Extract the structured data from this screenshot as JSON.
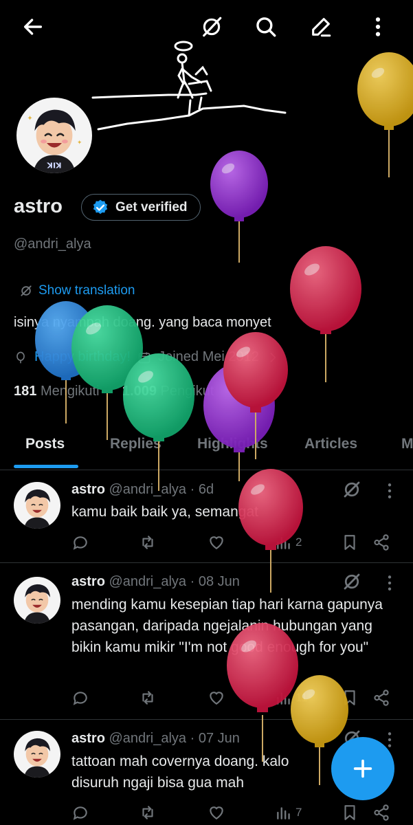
{
  "profile": {
    "name": "astro",
    "verify_label": "Get verified",
    "handle": "@andri_alya",
    "translate_label": "Show translation",
    "bio": "isinya nyampah doang.  yang baca monyet",
    "birthday": "Happy birthday!",
    "joined": "Joined Mei 2012",
    "following_count": "181",
    "following_label": "Mengikuti",
    "followers_count": "1.009",
    "followers_label": "Pengikut"
  },
  "tabs": [
    "Posts",
    "Replies",
    "Highlights",
    "Articles",
    "M"
  ],
  "posts": [
    {
      "name": "astro",
      "handle": "@andri_alya · 6d",
      "text": "kamu baik baik ya, semangat",
      "views": "2"
    },
    {
      "name": "astro",
      "handle": "@andri_alya · 08 Jun",
      "text": "mending kamu kesepian tiap hari karna gapunya pasangan, daripada ngejalanin hubungan yang bikin kamu mikir \"I'm not good enough for you\"",
      "views": "11"
    },
    {
      "name": "astro",
      "handle": "@andri_alya · 07 Jun",
      "text": "tattoan mah covernya doang. kalo disuruh ngaji bisa gua mah",
      "views": "7"
    }
  ],
  "icons": {
    "back": "arrow-left-icon",
    "grok": "grok-icon",
    "search": "search-icon",
    "edit": "pencil-icon",
    "more": "more-vertical-icon",
    "compose": "plus-icon"
  },
  "colors": {
    "accent": "#1d9bf0",
    "text": "#e7e9ea",
    "muted": "#71767b",
    "border": "#2f3336",
    "background": "#000000"
  }
}
